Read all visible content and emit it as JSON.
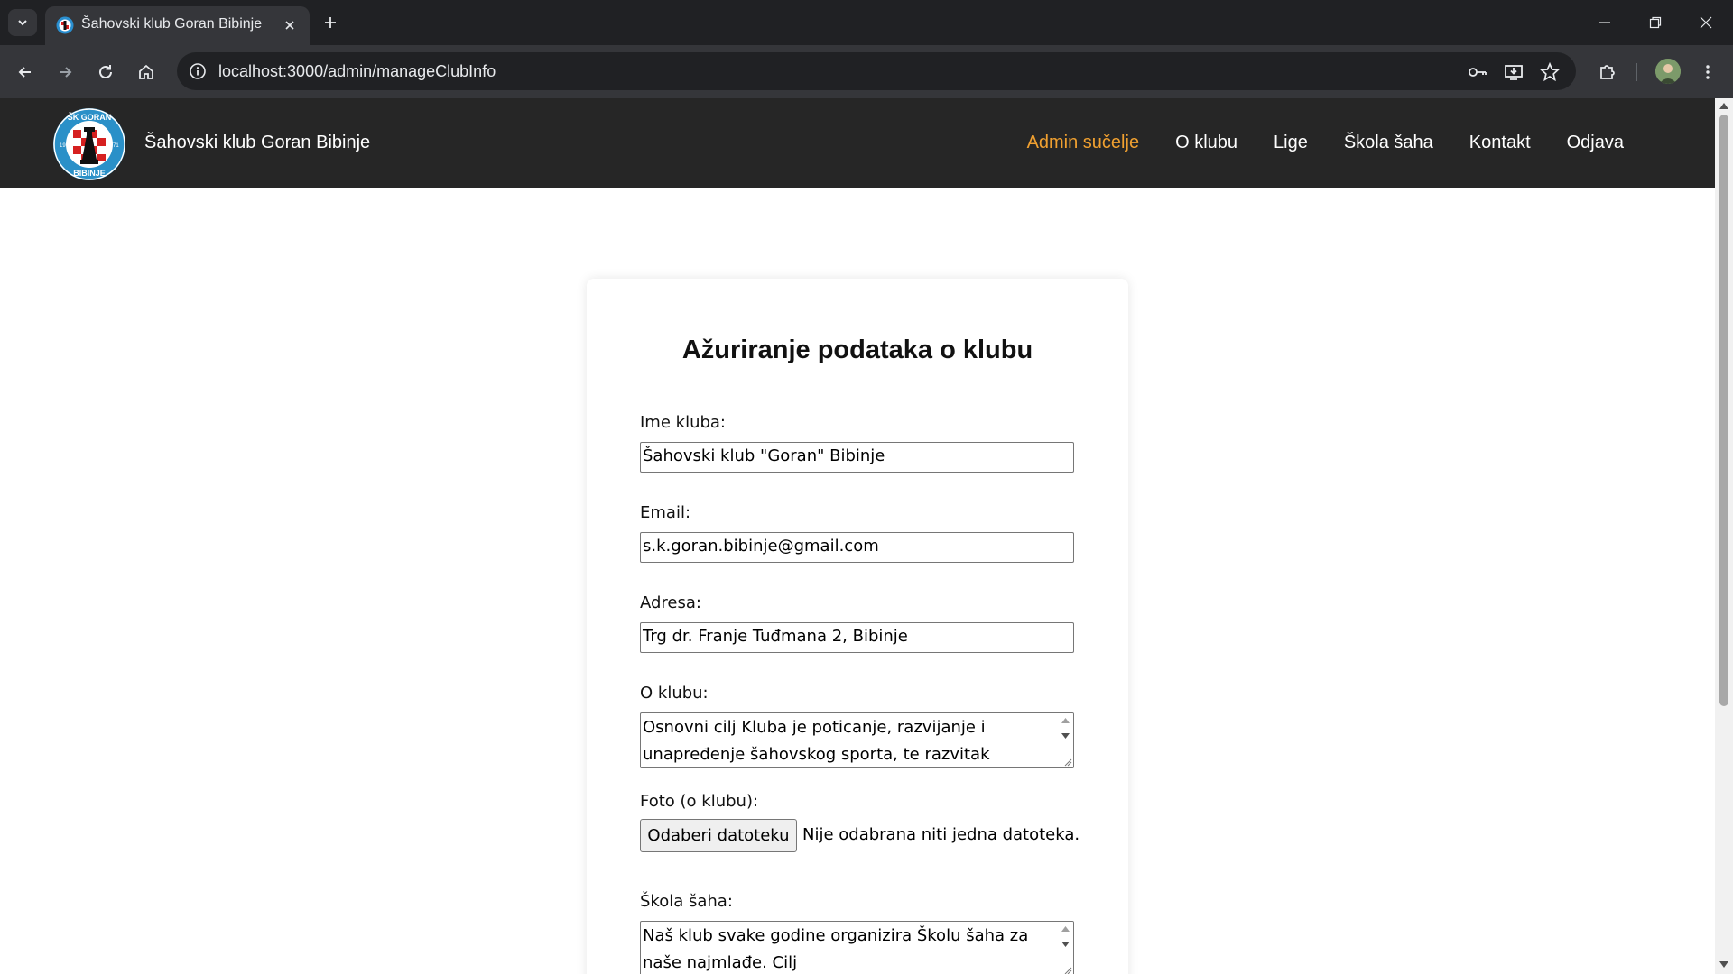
{
  "browser": {
    "tab_title": "Šahovski klub Goran Bibinje",
    "url": "localhost:3000/admin/manageClubInfo"
  },
  "site": {
    "brand": "Šahovski klub Goran Bibinje",
    "logo_text": "ŠK GORAN BIBINJE",
    "logo_year_left": "19",
    "logo_year_right": "71",
    "nav": [
      {
        "label": "Admin sučelje",
        "active": true
      },
      {
        "label": "O klubu",
        "active": false
      },
      {
        "label": "Lige",
        "active": false
      },
      {
        "label": "Škola šaha",
        "active": false
      },
      {
        "label": "Kontakt",
        "active": false
      },
      {
        "label": "Odjava",
        "active": false
      }
    ],
    "accent_color": "#f0a030",
    "header_color": "#262626"
  },
  "form": {
    "title": "Ažuriranje podataka o klubu",
    "name_label": "Ime kluba:",
    "name_value": "Šahovski klub \"Goran\" Bibinje",
    "email_label": "Email:",
    "email_value": "s.k.goran.bibinje@gmail.com",
    "address_label": "Adresa:",
    "address_value": "Trg dr. Franje Tuđmana 2, Bibinje",
    "about_label": "O klubu:",
    "about_value": "Osnovni cilj Kluba je poticanje, razvijanje i unapređenje šahovskog sporta, te razvitak",
    "photo_label": "Foto (o klubu):",
    "file_button": "Odaberi datoteku",
    "file_status": "Nije odabrana niti jedna datoteka.",
    "school_label": "Škola šaha:",
    "school_value": "Naš klub svake godine organizira Školu šaha za naše najmlađe. Cilj"
  }
}
